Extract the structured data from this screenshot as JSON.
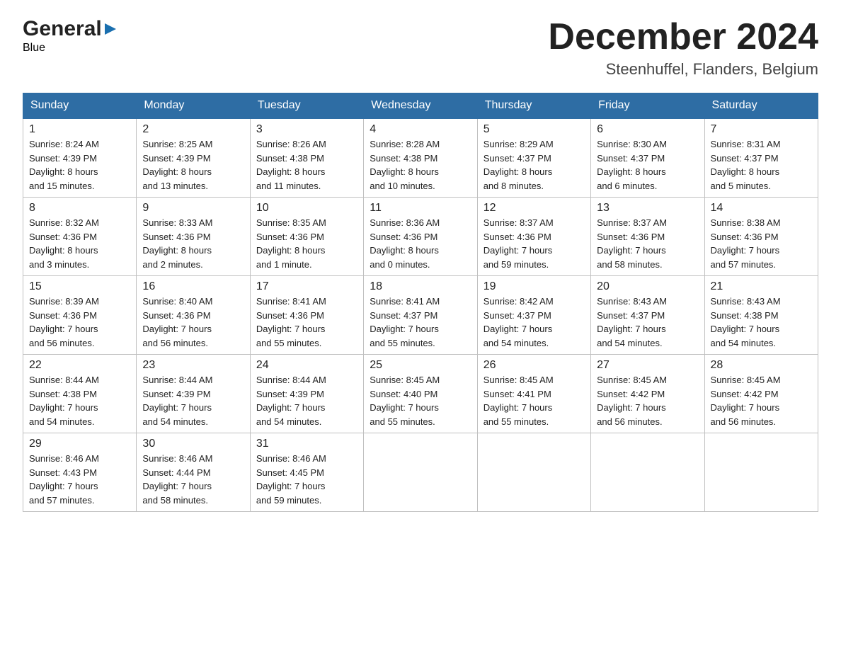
{
  "logo": {
    "line1": "General",
    "arrow": "▶",
    "line2": "Blue"
  },
  "title": "December 2024",
  "subtitle": "Steenhuffel, Flanders, Belgium",
  "weekdays": [
    "Sunday",
    "Monday",
    "Tuesday",
    "Wednesday",
    "Thursday",
    "Friday",
    "Saturday"
  ],
  "weeks": [
    [
      {
        "day": "1",
        "info": "Sunrise: 8:24 AM\nSunset: 4:39 PM\nDaylight: 8 hours\nand 15 minutes."
      },
      {
        "day": "2",
        "info": "Sunrise: 8:25 AM\nSunset: 4:39 PM\nDaylight: 8 hours\nand 13 minutes."
      },
      {
        "day": "3",
        "info": "Sunrise: 8:26 AM\nSunset: 4:38 PM\nDaylight: 8 hours\nand 11 minutes."
      },
      {
        "day": "4",
        "info": "Sunrise: 8:28 AM\nSunset: 4:38 PM\nDaylight: 8 hours\nand 10 minutes."
      },
      {
        "day": "5",
        "info": "Sunrise: 8:29 AM\nSunset: 4:37 PM\nDaylight: 8 hours\nand 8 minutes."
      },
      {
        "day": "6",
        "info": "Sunrise: 8:30 AM\nSunset: 4:37 PM\nDaylight: 8 hours\nand 6 minutes."
      },
      {
        "day": "7",
        "info": "Sunrise: 8:31 AM\nSunset: 4:37 PM\nDaylight: 8 hours\nand 5 minutes."
      }
    ],
    [
      {
        "day": "8",
        "info": "Sunrise: 8:32 AM\nSunset: 4:36 PM\nDaylight: 8 hours\nand 3 minutes."
      },
      {
        "day": "9",
        "info": "Sunrise: 8:33 AM\nSunset: 4:36 PM\nDaylight: 8 hours\nand 2 minutes."
      },
      {
        "day": "10",
        "info": "Sunrise: 8:35 AM\nSunset: 4:36 PM\nDaylight: 8 hours\nand 1 minute."
      },
      {
        "day": "11",
        "info": "Sunrise: 8:36 AM\nSunset: 4:36 PM\nDaylight: 8 hours\nand 0 minutes."
      },
      {
        "day": "12",
        "info": "Sunrise: 8:37 AM\nSunset: 4:36 PM\nDaylight: 7 hours\nand 59 minutes."
      },
      {
        "day": "13",
        "info": "Sunrise: 8:37 AM\nSunset: 4:36 PM\nDaylight: 7 hours\nand 58 minutes."
      },
      {
        "day": "14",
        "info": "Sunrise: 8:38 AM\nSunset: 4:36 PM\nDaylight: 7 hours\nand 57 minutes."
      }
    ],
    [
      {
        "day": "15",
        "info": "Sunrise: 8:39 AM\nSunset: 4:36 PM\nDaylight: 7 hours\nand 56 minutes."
      },
      {
        "day": "16",
        "info": "Sunrise: 8:40 AM\nSunset: 4:36 PM\nDaylight: 7 hours\nand 56 minutes."
      },
      {
        "day": "17",
        "info": "Sunrise: 8:41 AM\nSunset: 4:36 PM\nDaylight: 7 hours\nand 55 minutes."
      },
      {
        "day": "18",
        "info": "Sunrise: 8:41 AM\nSunset: 4:37 PM\nDaylight: 7 hours\nand 55 minutes."
      },
      {
        "day": "19",
        "info": "Sunrise: 8:42 AM\nSunset: 4:37 PM\nDaylight: 7 hours\nand 54 minutes."
      },
      {
        "day": "20",
        "info": "Sunrise: 8:43 AM\nSunset: 4:37 PM\nDaylight: 7 hours\nand 54 minutes."
      },
      {
        "day": "21",
        "info": "Sunrise: 8:43 AM\nSunset: 4:38 PM\nDaylight: 7 hours\nand 54 minutes."
      }
    ],
    [
      {
        "day": "22",
        "info": "Sunrise: 8:44 AM\nSunset: 4:38 PM\nDaylight: 7 hours\nand 54 minutes."
      },
      {
        "day": "23",
        "info": "Sunrise: 8:44 AM\nSunset: 4:39 PM\nDaylight: 7 hours\nand 54 minutes."
      },
      {
        "day": "24",
        "info": "Sunrise: 8:44 AM\nSunset: 4:39 PM\nDaylight: 7 hours\nand 54 minutes."
      },
      {
        "day": "25",
        "info": "Sunrise: 8:45 AM\nSunset: 4:40 PM\nDaylight: 7 hours\nand 55 minutes."
      },
      {
        "day": "26",
        "info": "Sunrise: 8:45 AM\nSunset: 4:41 PM\nDaylight: 7 hours\nand 55 minutes."
      },
      {
        "day": "27",
        "info": "Sunrise: 8:45 AM\nSunset: 4:42 PM\nDaylight: 7 hours\nand 56 minutes."
      },
      {
        "day": "28",
        "info": "Sunrise: 8:45 AM\nSunset: 4:42 PM\nDaylight: 7 hours\nand 56 minutes."
      }
    ],
    [
      {
        "day": "29",
        "info": "Sunrise: 8:46 AM\nSunset: 4:43 PM\nDaylight: 7 hours\nand 57 minutes."
      },
      {
        "day": "30",
        "info": "Sunrise: 8:46 AM\nSunset: 4:44 PM\nDaylight: 7 hours\nand 58 minutes."
      },
      {
        "day": "31",
        "info": "Sunrise: 8:46 AM\nSunset: 4:45 PM\nDaylight: 7 hours\nand 59 minutes."
      },
      {
        "day": "",
        "info": ""
      },
      {
        "day": "",
        "info": ""
      },
      {
        "day": "",
        "info": ""
      },
      {
        "day": "",
        "info": ""
      }
    ]
  ]
}
